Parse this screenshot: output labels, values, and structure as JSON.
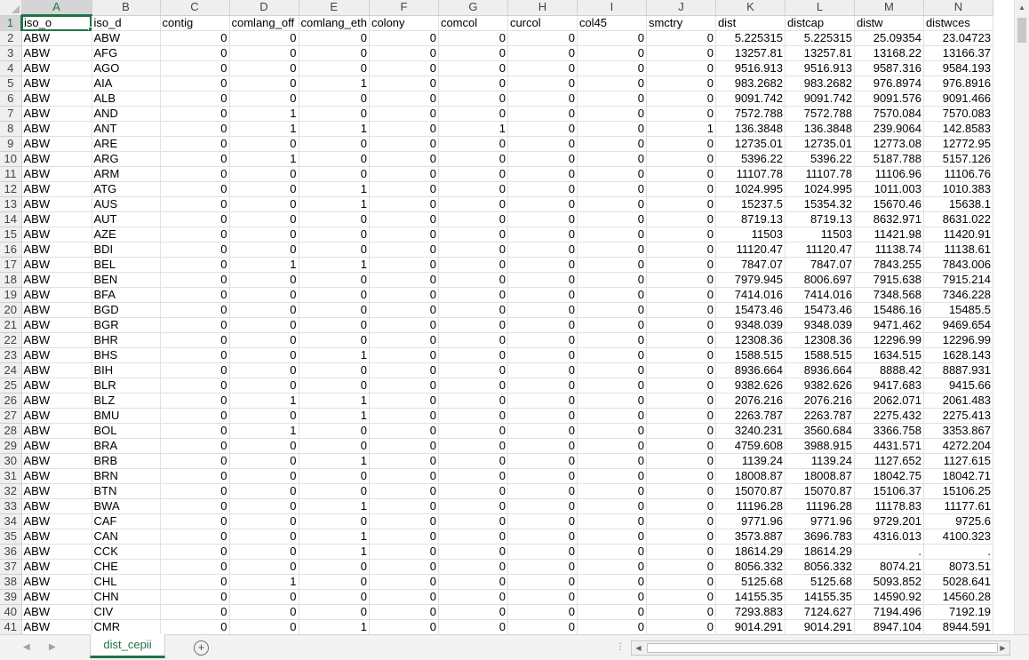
{
  "columns": [
    "A",
    "B",
    "C",
    "D",
    "E",
    "F",
    "G",
    "H",
    "I",
    "J",
    "K",
    "L",
    "M",
    "N"
  ],
  "selected_column": "A",
  "selected_row": 1,
  "headers": [
    "iso_o",
    "iso_d",
    "contig",
    "comlang_off",
    "comlang_eth",
    "colony",
    "comcol",
    "curcol",
    "col45",
    "smctry",
    "dist",
    "distcap",
    "distw",
    "distwces"
  ],
  "rows": [
    [
      "ABW",
      "ABW",
      "0",
      "0",
      "0",
      "0",
      "0",
      "0",
      "0",
      "0",
      "5.225315",
      "5.225315",
      "25.09354",
      "23.04723"
    ],
    [
      "ABW",
      "AFG",
      "0",
      "0",
      "0",
      "0",
      "0",
      "0",
      "0",
      "0",
      "13257.81",
      "13257.81",
      "13168.22",
      "13166.37"
    ],
    [
      "ABW",
      "AGO",
      "0",
      "0",
      "0",
      "0",
      "0",
      "0",
      "0",
      "0",
      "9516.913",
      "9516.913",
      "9587.316",
      "9584.193"
    ],
    [
      "ABW",
      "AIA",
      "0",
      "0",
      "1",
      "0",
      "0",
      "0",
      "0",
      "0",
      "983.2682",
      "983.2682",
      "976.8974",
      "976.8916"
    ],
    [
      "ABW",
      "ALB",
      "0",
      "0",
      "0",
      "0",
      "0",
      "0",
      "0",
      "0",
      "9091.742",
      "9091.742",
      "9091.576",
      "9091.466"
    ],
    [
      "ABW",
      "AND",
      "0",
      "1",
      "0",
      "0",
      "0",
      "0",
      "0",
      "0",
      "7572.788",
      "7572.788",
      "7570.084",
      "7570.083"
    ],
    [
      "ABW",
      "ANT",
      "0",
      "1",
      "1",
      "0",
      "1",
      "0",
      "0",
      "1",
      "136.3848",
      "136.3848",
      "239.9064",
      "142.8583"
    ],
    [
      "ABW",
      "ARE",
      "0",
      "0",
      "0",
      "0",
      "0",
      "0",
      "0",
      "0",
      "12735.01",
      "12735.01",
      "12773.08",
      "12772.95"
    ],
    [
      "ABW",
      "ARG",
      "0",
      "1",
      "0",
      "0",
      "0",
      "0",
      "0",
      "0",
      "5396.22",
      "5396.22",
      "5187.788",
      "5157.126"
    ],
    [
      "ABW",
      "ARM",
      "0",
      "0",
      "0",
      "0",
      "0",
      "0",
      "0",
      "0",
      "11107.78",
      "11107.78",
      "11106.96",
      "11106.76"
    ],
    [
      "ABW",
      "ATG",
      "0",
      "0",
      "1",
      "0",
      "0",
      "0",
      "0",
      "0",
      "1024.995",
      "1024.995",
      "1011.003",
      "1010.383"
    ],
    [
      "ABW",
      "AUS",
      "0",
      "0",
      "1",
      "0",
      "0",
      "0",
      "0",
      "0",
      "15237.5",
      "15354.32",
      "15670.46",
      "15638.1"
    ],
    [
      "ABW",
      "AUT",
      "0",
      "0",
      "0",
      "0",
      "0",
      "0",
      "0",
      "0",
      "8719.13",
      "8719.13",
      "8632.971",
      "8631.022"
    ],
    [
      "ABW",
      "AZE",
      "0",
      "0",
      "0",
      "0",
      "0",
      "0",
      "0",
      "0",
      "11503",
      "11503",
      "11421.98",
      "11420.91"
    ],
    [
      "ABW",
      "BDI",
      "0",
      "0",
      "0",
      "0",
      "0",
      "0",
      "0",
      "0",
      "11120.47",
      "11120.47",
      "11138.74",
      "11138.61"
    ],
    [
      "ABW",
      "BEL",
      "0",
      "1",
      "1",
      "0",
      "0",
      "0",
      "0",
      "0",
      "7847.07",
      "7847.07",
      "7843.255",
      "7843.006"
    ],
    [
      "ABW",
      "BEN",
      "0",
      "0",
      "0",
      "0",
      "0",
      "0",
      "0",
      "0",
      "7979.945",
      "8006.697",
      "7915.638",
      "7915.214"
    ],
    [
      "ABW",
      "BFA",
      "0",
      "0",
      "0",
      "0",
      "0",
      "0",
      "0",
      "0",
      "7414.016",
      "7414.016",
      "7348.568",
      "7346.228"
    ],
    [
      "ABW",
      "BGD",
      "0",
      "0",
      "0",
      "0",
      "0",
      "0",
      "0",
      "0",
      "15473.46",
      "15473.46",
      "15486.16",
      "15485.5"
    ],
    [
      "ABW",
      "BGR",
      "0",
      "0",
      "0",
      "0",
      "0",
      "0",
      "0",
      "0",
      "9348.039",
      "9348.039",
      "9471.462",
      "9469.654"
    ],
    [
      "ABW",
      "BHR",
      "0",
      "0",
      "0",
      "0",
      "0",
      "0",
      "0",
      "0",
      "12308.36",
      "12308.36",
      "12296.99",
      "12296.99"
    ],
    [
      "ABW",
      "BHS",
      "0",
      "0",
      "1",
      "0",
      "0",
      "0",
      "0",
      "0",
      "1588.515",
      "1588.515",
      "1634.515",
      "1628.143"
    ],
    [
      "ABW",
      "BIH",
      "0",
      "0",
      "0",
      "0",
      "0",
      "0",
      "0",
      "0",
      "8936.664",
      "8936.664",
      "8888.42",
      "8887.931"
    ],
    [
      "ABW",
      "BLR",
      "0",
      "0",
      "0",
      "0",
      "0",
      "0",
      "0",
      "0",
      "9382.626",
      "9382.626",
      "9417.683",
      "9415.66"
    ],
    [
      "ABW",
      "BLZ",
      "0",
      "1",
      "1",
      "0",
      "0",
      "0",
      "0",
      "0",
      "2076.216",
      "2076.216",
      "2062.071",
      "2061.483"
    ],
    [
      "ABW",
      "BMU",
      "0",
      "0",
      "1",
      "0",
      "0",
      "0",
      "0",
      "0",
      "2263.787",
      "2263.787",
      "2275.432",
      "2275.413"
    ],
    [
      "ABW",
      "BOL",
      "0",
      "1",
      "0",
      "0",
      "0",
      "0",
      "0",
      "0",
      "3240.231",
      "3560.684",
      "3366.758",
      "3353.867"
    ],
    [
      "ABW",
      "BRA",
      "0",
      "0",
      "0",
      "0",
      "0",
      "0",
      "0",
      "0",
      "4759.608",
      "3988.915",
      "4431.571",
      "4272.204"
    ],
    [
      "ABW",
      "BRB",
      "0",
      "0",
      "1",
      "0",
      "0",
      "0",
      "0",
      "0",
      "1139.24",
      "1139.24",
      "1127.652",
      "1127.615"
    ],
    [
      "ABW",
      "BRN",
      "0",
      "0",
      "0",
      "0",
      "0",
      "0",
      "0",
      "0",
      "18008.87",
      "18008.87",
      "18042.75",
      "18042.71"
    ],
    [
      "ABW",
      "BTN",
      "0",
      "0",
      "0",
      "0",
      "0",
      "0",
      "0",
      "0",
      "15070.87",
      "15070.87",
      "15106.37",
      "15106.25"
    ],
    [
      "ABW",
      "BWA",
      "0",
      "0",
      "1",
      "0",
      "0",
      "0",
      "0",
      "0",
      "11196.28",
      "11196.28",
      "11178.83",
      "11177.61"
    ],
    [
      "ABW",
      "CAF",
      "0",
      "0",
      "0",
      "0",
      "0",
      "0",
      "0",
      "0",
      "9771.96",
      "9771.96",
      "9729.201",
      "9725.6"
    ],
    [
      "ABW",
      "CAN",
      "0",
      "0",
      "1",
      "0",
      "0",
      "0",
      "0",
      "0",
      "3573.887",
      "3696.783",
      "4316.013",
      "4100.323"
    ],
    [
      "ABW",
      "CCK",
      "0",
      "0",
      "1",
      "0",
      "0",
      "0",
      "0",
      "0",
      "18614.29",
      "18614.29",
      ".",
      "."
    ],
    [
      "ABW",
      "CHE",
      "0",
      "0",
      "0",
      "0",
      "0",
      "0",
      "0",
      "0",
      "8056.332",
      "8056.332",
      "8074.21",
      "8073.51"
    ],
    [
      "ABW",
      "CHL",
      "0",
      "1",
      "0",
      "0",
      "0",
      "0",
      "0",
      "0",
      "5125.68",
      "5125.68",
      "5093.852",
      "5028.641"
    ],
    [
      "ABW",
      "CHN",
      "0",
      "0",
      "0",
      "0",
      "0",
      "0",
      "0",
      "0",
      "14155.35",
      "14155.35",
      "14590.92",
      "14560.28"
    ],
    [
      "ABW",
      "CIV",
      "0",
      "0",
      "0",
      "0",
      "0",
      "0",
      "0",
      "0",
      "7293.883",
      "7124.627",
      "7194.496",
      "7192.19"
    ],
    [
      "ABW",
      "CMR",
      "0",
      "0",
      "1",
      "0",
      "0",
      "0",
      "0",
      "0",
      "9014.291",
      "9014.291",
      "8947.104",
      "8944.591"
    ]
  ],
  "text_columns": [
    0,
    1
  ],
  "sheet_tab_label": "dist_cepii",
  "icons": {
    "add_sheet": "plus-circle-icon",
    "nav_prev": "triangle-left-icon",
    "nav_next": "triangle-right-icon"
  },
  "colors": {
    "accent": "#217346"
  }
}
